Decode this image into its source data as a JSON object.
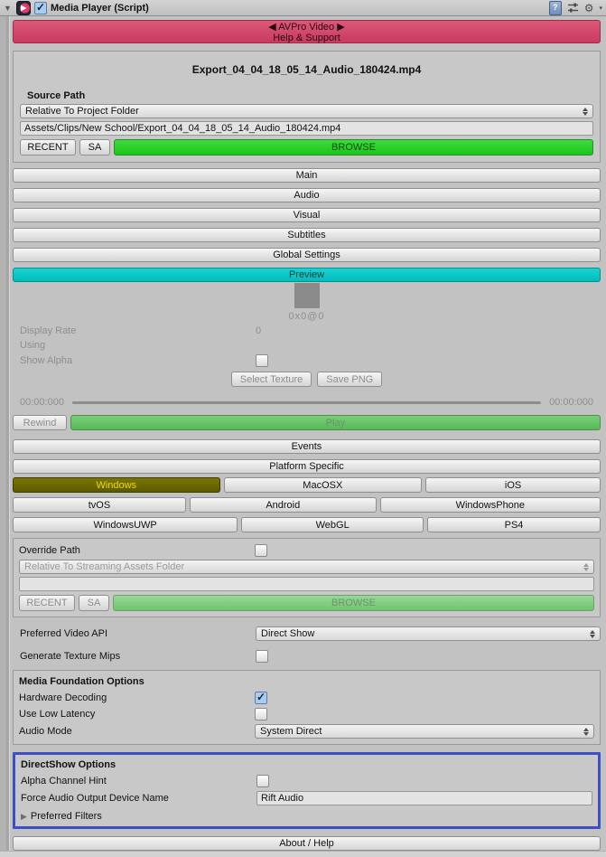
{
  "colors": {
    "accent_pink": "#D04A6C",
    "accent_cyan": "#0DC4C4",
    "accent_green": "#2ED02E",
    "selected_olive": "#6F6B00",
    "highlight_blue": "#3D4FC4"
  },
  "icons": {
    "foldout_open": "▼",
    "foldout_closed": "▶",
    "help_glyph": "?",
    "gear": "⚙",
    "gear_caret": "▾"
  },
  "header": {
    "title": "Media Player (Script)",
    "enabled": true
  },
  "banner": {
    "line1": "◀ AVPro Video ▶",
    "line2": "Help & Support"
  },
  "source": {
    "filename": "Export_04_04_18_05_14_Audio_180424.mp4",
    "label": "Source Path",
    "location_dropdown": "Relative To Project Folder",
    "path": "Assets/Clips/New School/Export_04_04_18_05_14_Audio_180424.mp4",
    "recent": "RECENT",
    "sa": "SA",
    "browse": "BROWSE"
  },
  "sections": {
    "items": [
      "Main",
      "Audio",
      "Visual",
      "Subtitles",
      "Global Settings",
      "Preview"
    ]
  },
  "preview": {
    "resolution": "0x0@0",
    "display_rate_label": "Display Rate",
    "display_rate_value": "0",
    "using_label": "Using",
    "show_alpha_label": "Show Alpha",
    "show_alpha_checked": false,
    "select_texture": "Select Texture",
    "save_png": "Save PNG",
    "time_left": "00:00:000",
    "time_right": "00:00:000",
    "rewind": "Rewind",
    "play": "Play"
  },
  "nav": {
    "events": "Events",
    "platform_specific": "Platform Specific"
  },
  "platforms": {
    "items": [
      "Windows",
      "MacOSX",
      "iOS",
      "tvOS",
      "Android",
      "WindowsPhone",
      "WindowsUWP",
      "WebGL",
      "PS4"
    ],
    "selected": "Windows"
  },
  "override": {
    "label": "Override Path",
    "enabled": false,
    "location_dropdown": "Relative To Streaming Assets Folder",
    "path": "",
    "recent": "RECENT",
    "sa": "SA",
    "browse": "BROWSE"
  },
  "prefs": {
    "video_api_label": "Preferred Video API",
    "video_api_value": "Direct Show",
    "texture_mips_label": "Generate Texture Mips",
    "texture_mips_checked": false
  },
  "media_foundation": {
    "title": "Media Foundation Options",
    "hardware_decoding_label": "Hardware Decoding",
    "hardware_decoding_checked": true,
    "low_latency_label": "Use Low Latency",
    "low_latency_checked": false,
    "audio_mode_label": "Audio Mode",
    "audio_mode_value": "System Direct"
  },
  "directshow": {
    "title": "DirectShow Options",
    "alpha_hint_label": "Alpha Channel Hint",
    "alpha_hint_checked": false,
    "force_audio_label": "Force Audio Output Device Name",
    "force_audio_value": "Rift Audio",
    "preferred_filters_label": "Preferred Filters"
  },
  "footer": {
    "about": "About / Help"
  }
}
